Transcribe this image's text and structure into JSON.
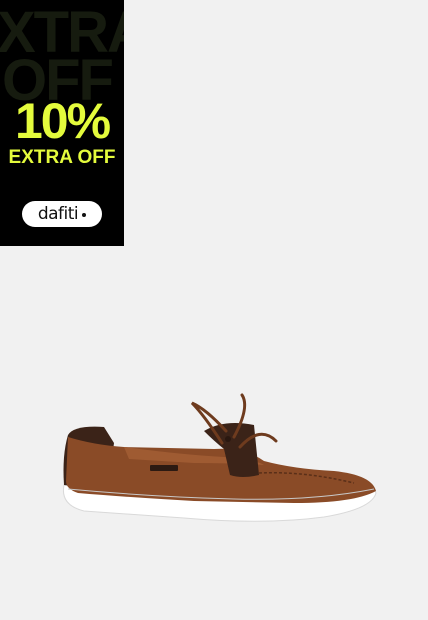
{
  "promo": {
    "bg_line1": "XTRA",
    "bg_line2": "OFF",
    "discount": "10%",
    "label": "EXTRA OFF",
    "brand": "dafiti",
    "accent_color": "#e4fb3c",
    "background_color": "#000000"
  },
  "product": {
    "image": "brown-boat-shoe",
    "sole_color": "#ffffff",
    "upper_color": "#8a4b27",
    "collar_color": "#3b2318"
  }
}
